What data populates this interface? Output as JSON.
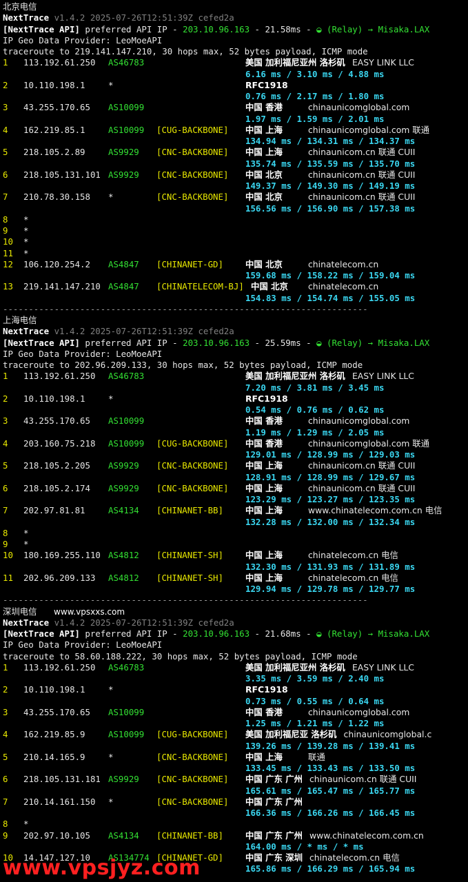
{
  "sections": [
    {
      "title": "北京电信",
      "version_line": {
        "name": "NextTrace",
        "version": "v1.4.2 2025-07-26T12:51:39Z cefed2a"
      },
      "api_line": {
        "prefix": "[NextTrace API]",
        "text": " preferred API IP - ",
        "ip": "203.10.96.163",
        "ms": " - 21.58ms - ",
        "relay": "◒ (Relay) → Misaka.LAX"
      },
      "geo_line": "IP Geo Data Provider: LeoMoeAPI",
      "trace_line": "traceroute to 219.141.147.210, 30 hops max, 52 bytes payload, ICMP mode",
      "hops": [
        {
          "n": "1",
          "ip": "113.192.61.250",
          "as": "AS46783",
          "tag": "",
          "geo": "美国 加利福尼亚州 洛杉矶",
          "org": "EASY LINK LLC",
          "rtt": "6.16 ms / 3.10 ms / 4.88 ms"
        },
        {
          "n": "2",
          "ip": "10.110.198.1",
          "as": "*",
          "tag": "",
          "geo": "RFC1918",
          "org": "",
          "rtt": "0.76 ms / 2.17 ms / 1.80 ms"
        },
        {
          "n": "3",
          "ip": "43.255.170.65",
          "as": "AS10099",
          "tag": "",
          "geo": "中国 香港",
          "org": "chinaunicomglobal.com",
          "rtt": "1.97 ms / 1.59 ms / 2.01 ms"
        },
        {
          "n": "4",
          "ip": "162.219.85.1",
          "as": "AS10099",
          "tag": "[CUG-BACKBONE]",
          "geo": "中国 上海",
          "org": "chinaunicomglobal.com  联通",
          "rtt": "134.94 ms / 134.31 ms / 134.37 ms"
        },
        {
          "n": "5",
          "ip": "218.105.2.89",
          "as": "AS9929",
          "tag": "[CNC-BACKBONE]",
          "geo": "中国 上海",
          "org": "chinaunicom.cn  联通 CUII",
          "rtt": "135.74 ms / 135.59 ms / 135.70 ms"
        },
        {
          "n": "6",
          "ip": "218.105.131.101",
          "as": "AS9929",
          "tag": "[CNC-BACKBONE]",
          "geo": "中国 北京",
          "org": "chinaunicom.cn  联通 CUII",
          "rtt": "149.37 ms / 149.30 ms / 149.19 ms"
        },
        {
          "n": "7",
          "ip": "210.78.30.158",
          "as": "*",
          "tag": "[CNC-BACKBONE]",
          "geo": "中国 北京",
          "org": "chinaunicom.cn  联通 CUII",
          "rtt": "156.56 ms / 156.90 ms / 157.38 ms"
        },
        {
          "n": "8",
          "star": "*"
        },
        {
          "n": "9",
          "star": "*"
        },
        {
          "n": "10",
          "star": "*"
        },
        {
          "n": "11",
          "star": "*"
        },
        {
          "n": "12",
          "ip": "106.120.254.2",
          "as": "AS4847",
          "tag": "[CHINANET-GD]",
          "geo": "中国 北京",
          "org": "chinatelecom.cn",
          "rtt": "159.68 ms / 158.22 ms / 159.04 ms"
        },
        {
          "n": "13",
          "ip": "219.141.147.210",
          "as": "AS4847",
          "tag": "[CHINATELECOM-BJ]",
          "geo": "中国 北京",
          "org": "chinatelecom.cn",
          "rtt": "154.83 ms / 154.74 ms / 155.05 ms"
        }
      ]
    },
    {
      "title": "上海电信",
      "version_line": {
        "name": "NextTrace",
        "version": "v1.4.2 2025-07-26T12:51:39Z cefed2a"
      },
      "api_line": {
        "prefix": "[NextTrace API]",
        "text": " preferred API IP - ",
        "ip": "203.10.96.163",
        "ms": " - 25.59ms - ",
        "relay": "◒ (Relay) → Misaka.LAX"
      },
      "geo_line": "IP Geo Data Provider: LeoMoeAPI",
      "trace_line": "traceroute to 202.96.209.133, 30 hops max, 52 bytes payload, ICMP mode",
      "hops": [
        {
          "n": "1",
          "ip": "113.192.61.250",
          "as": "AS46783",
          "tag": "",
          "geo": "美国 加利福尼亚州 洛杉矶",
          "org": "EASY LINK LLC",
          "rtt": "7.20 ms / 3.81 ms / 3.45 ms"
        },
        {
          "n": "2",
          "ip": "10.110.198.1",
          "as": "*",
          "tag": "",
          "geo": "RFC1918",
          "org": "",
          "rtt": "0.54 ms / 0.76 ms / 0.62 ms"
        },
        {
          "n": "3",
          "ip": "43.255.170.65",
          "as": "AS10099",
          "tag": "",
          "geo": "中国 香港",
          "org": "chinaunicomglobal.com",
          "rtt": "1.19 ms / 1.29 ms / 2.05 ms"
        },
        {
          "n": "4",
          "ip": "203.160.75.218",
          "as": "AS10099",
          "tag": "[CUG-BACKBONE]",
          "geo": "中国 香港",
          "org": "chinaunicomglobal.com  联通",
          "rtt": "129.01 ms / 128.99 ms / 129.03 ms"
        },
        {
          "n": "5",
          "ip": "218.105.2.205",
          "as": "AS9929",
          "tag": "[CNC-BACKBONE]",
          "geo": "中国 上海",
          "org": "chinaunicom.cn  联通 CUII",
          "rtt": "128.91 ms / 128.99 ms / 129.67 ms"
        },
        {
          "n": "6",
          "ip": "218.105.2.174",
          "as": "AS9929",
          "tag": "[CNC-BACKBONE]",
          "geo": "中国 上海",
          "org": "chinaunicom.cn  联通 CUII",
          "rtt": "123.29 ms / 123.27 ms / 123.35 ms"
        },
        {
          "n": "7",
          "ip": "202.97.81.81",
          "as": "AS4134",
          "tag": "[CHINANET-BB]",
          "geo": "中国 上海",
          "org": "www.chinatelecom.com.cn  电信",
          "rtt": "132.28 ms / 132.00 ms / 132.34 ms"
        },
        {
          "n": "8",
          "star": "*"
        },
        {
          "n": "9",
          "star": "*"
        },
        {
          "n": "10",
          "ip": "180.169.255.110",
          "as": "AS4812",
          "tag": "[CHINANET-SH]",
          "geo": "中国 上海",
          "org": "chinatelecom.cn  电信",
          "rtt": "132.30 ms / 131.93 ms / 131.89 ms"
        },
        {
          "n": "11",
          "ip": "202.96.209.133",
          "as": "AS4812",
          "tag": "[CHINANET-SH]",
          "geo": "中国 上海",
          "org": "chinatelecom.cn  电信",
          "rtt": "129.94 ms / 129.78 ms / 129.77 ms"
        }
      ]
    },
    {
      "title": "深圳电信",
      "version_line": {
        "name": "NextTrace",
        "version": "v1.4.2 2025-07-26T12:51:39Z cefed2a"
      },
      "api_line": {
        "prefix": "[NextTrace API]",
        "text": " preferred API IP - ",
        "ip": "203.10.96.163",
        "ms": " - 21.68ms - ",
        "relay": "◒ (Relay) → Misaka.LAX"
      },
      "geo_line": "IP Geo Data Provider: LeoMoeAPI",
      "trace_line": "traceroute to 58.60.188.222, 30 hops max, 52 bytes payload, ICMP mode",
      "hops": [
        {
          "n": "1",
          "ip": "113.192.61.250",
          "as": "AS46783",
          "tag": "",
          "geo": "美国 加利福尼亚州 洛杉矶",
          "org": "EASY LINK LLC",
          "rtt": "3.35 ms / 3.59 ms / 2.40 ms"
        },
        {
          "n": "2",
          "ip": "10.110.198.1",
          "as": "*",
          "tag": "",
          "geo": "RFC1918",
          "org": "",
          "rtt": "0.73 ms / 0.55 ms / 0.64 ms"
        },
        {
          "n": "3",
          "ip": "43.255.170.65",
          "as": "AS10099",
          "tag": "",
          "geo": "中国 香港",
          "org": "chinaunicomglobal.com",
          "rtt": "1.25 ms / 1.21 ms / 1.22 ms"
        },
        {
          "n": "4",
          "ip": "162.219.85.9",
          "as": "AS10099",
          "tag": "[CUG-BACKBONE]",
          "geo": "美国 加利福尼亚 洛杉矶",
          "org": "chinaunicomglobal.c",
          "rtt": "139.26 ms / 139.28 ms / 139.41 ms"
        },
        {
          "n": "5",
          "ip": "210.14.165.9",
          "as": "*",
          "tag": "[CNC-BACKBONE]",
          "geo": "中国 上海",
          "org": "联通",
          "rtt": "133.45 ms / 133.43 ms / 133.50 ms"
        },
        {
          "n": "6",
          "ip": "218.105.131.181",
          "as": "AS9929",
          "tag": "[CNC-BACKBONE]",
          "geo": "中国 广东 广州",
          "org": "chinaunicom.cn  联通 CUII",
          "rtt": "165.61 ms / 165.47 ms / 165.77 ms"
        },
        {
          "n": "7",
          "ip": "210.14.161.150",
          "as": "*",
          "tag": "[CNC-BACKBONE]",
          "geo": "中国 广东 广州",
          "org": "",
          "rtt": "166.36 ms / 166.26 ms / 166.45 ms"
        },
        {
          "n": "8",
          "star": "*"
        },
        {
          "n": "9",
          "ip": "202.97.10.105",
          "as": "AS4134",
          "tag": "[CHINANET-BB]",
          "geo": "中国 广东 广州",
          "org": "www.chinatelecom.com.cn",
          "rtt": "164.00 ms / * ms / * ms"
        },
        {
          "n": "10",
          "ip": "14.147.127.10",
          "as": "AS134774",
          "tag": "[CHINANET-GD]",
          "geo": "中国 广东 深圳",
          "org": "chinatelecom.cn  电信",
          "rtt": "165.86 ms / 166.29 ms / 165.94 ms"
        }
      ]
    }
  ],
  "separator": "-----------------------------------------------------------------------",
  "watermark_small": "www.vpsxxs.com",
  "watermark_large": "www.vpsjyz.com",
  "colors": {
    "background": "#000000",
    "cyan": "#3ad6f0",
    "yellow": "#e8e800",
    "green": "#33e033",
    "watermark": "#ff2020"
  }
}
